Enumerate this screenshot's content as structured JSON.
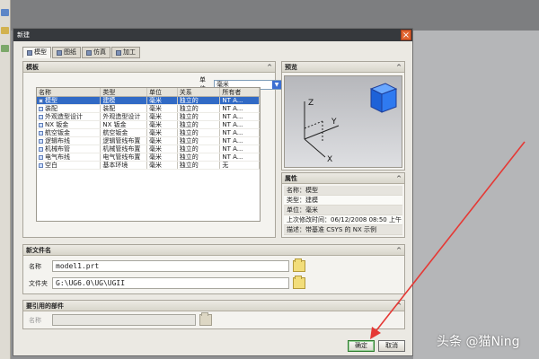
{
  "dialog": {
    "title": "新建",
    "close_label": "×"
  },
  "tabs": [
    {
      "label": "模型"
    },
    {
      "label": "图纸"
    },
    {
      "label": "仿真"
    },
    {
      "label": "加工"
    }
  ],
  "templates": {
    "header": "模板",
    "unit_label": "单位",
    "unit_value": "毫米",
    "columns": [
      "名称",
      "类型",
      "单位",
      "关系",
      "所有者"
    ],
    "rows": [
      [
        "模型",
        "建模",
        "毫米",
        "独立的",
        "NT A..."
      ],
      [
        "装配",
        "装配",
        "毫米",
        "独立的",
        "NT A..."
      ],
      [
        "外观造型设计",
        "外观造型设计",
        "毫米",
        "独立的",
        "NT A..."
      ],
      [
        "NX 钣金",
        "NX 钣金",
        "毫米",
        "独立的",
        "NT A..."
      ],
      [
        "航空钣金",
        "航空钣金",
        "毫米",
        "独立的",
        "NT A..."
      ],
      [
        "逻辑布线",
        "逻辑管线布置",
        "毫米",
        "独立的",
        "NT A..."
      ],
      [
        "机械布管",
        "机械管线布置",
        "毫米",
        "独立的",
        "NT A..."
      ],
      [
        "电气布线",
        "电气管线布置",
        "毫米",
        "独立的",
        "NT A..."
      ],
      [
        "空白",
        "基本环境",
        "毫米",
        "独立的",
        "无"
      ]
    ]
  },
  "preview": {
    "header": "预览",
    "axis_z": "Z",
    "axis_y": "Y",
    "axis_x": "X"
  },
  "properties": {
    "header": "属性",
    "rows": [
      "名称：模型",
      "类型：建模",
      "单位：毫米",
      "上次修改时间：06/12/2008 08:50 上午",
      "描述：带基准 CSYS 的 NX 示例"
    ]
  },
  "new_file": {
    "header": "新文件名",
    "name_label": "名称",
    "name_value": "model1.prt",
    "folder_label": "文件夹",
    "folder_value": "G:\\UG6.0\\UG\\UGII"
  },
  "reference": {
    "header": "要引用的部件",
    "name_label": "名称",
    "name_value": ""
  },
  "buttons": {
    "ok": "确定",
    "cancel": "取消"
  },
  "watermark": "头条 @猫Ning",
  "colors": {
    "selection": "#316ac5",
    "arrow": "#e53935",
    "close": "#e0632f"
  }
}
